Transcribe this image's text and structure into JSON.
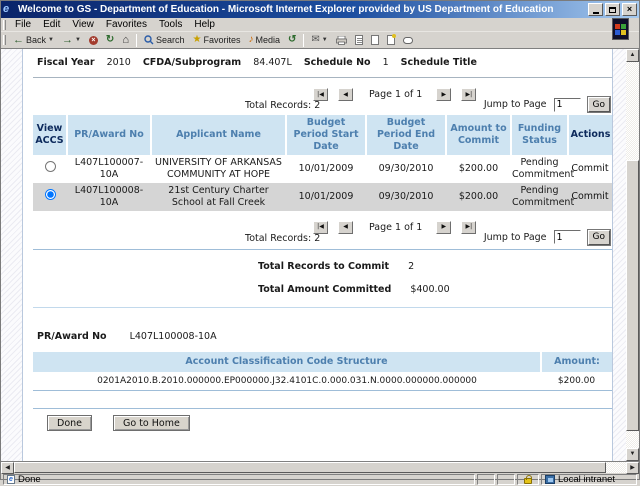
{
  "titlebar": {
    "title": "Welcome to GS - Department of Education - Microsoft Internet Explorer provided by US Department of Education"
  },
  "menubar": {
    "items": [
      "File",
      "Edit",
      "View",
      "Favorites",
      "Tools",
      "Help"
    ]
  },
  "toolbar": {
    "back_label": "Back",
    "search_label": "Search",
    "favorites_label": "Favorites",
    "media_label": "Media"
  },
  "icons": {
    "ie_e": "e",
    "back": "←",
    "forward": "→",
    "stop": "×",
    "refresh": "↻",
    "home": "⌂",
    "favorites": "★",
    "media": "♪",
    "history": "↺",
    "mail": "✉",
    "close": "×",
    "up": "▲",
    "down": "▼",
    "left": "◀",
    "right": "▶"
  },
  "page": {
    "header_fields": {
      "fy_label": "Fiscal Year",
      "fy": "2010",
      "cfda_label": "CFDA/Subprogram",
      "cfda": "84.407L",
      "sched_label": "Schedule No",
      "sched": "1",
      "title_label": "Schedule Title"
    },
    "pagination": {
      "total_label": "Total Records:",
      "total": "2",
      "first": "|◀",
      "prev": "◀",
      "next": "▶",
      "last": "▶|",
      "page": "Page 1 of 1",
      "jump_label": "Jump to Page",
      "jump_value": "1",
      "go": "Go"
    },
    "table": {
      "headers": [
        "View ACCS",
        "PR/Award No",
        "Applicant Name",
        "Budget Period Start Date",
        "Budget Period End Date",
        "Amount to Commit",
        "Funding Status",
        "Actions"
      ],
      "rows": [
        {
          "selected": false,
          "pr_award_no": "L407L100007-10A",
          "applicant": "UNIVERSITY OF ARKANSAS COMMUNITY AT HOPE",
          "start": "10/01/2009",
          "end": "09/30/2010",
          "amount": "$200.00",
          "status": "Pending Commitment",
          "action": "Commit"
        },
        {
          "selected": true,
          "pr_award_no": "L407L100008-10A",
          "applicant": "21st Century Charter School at Fall Creek",
          "start": "10/01/2009",
          "end": "09/30/2010",
          "amount": "$200.00",
          "status": "Pending Commitment",
          "action": "Commit"
        }
      ]
    },
    "totals": {
      "records_label": "Total Records to Commit",
      "records_value": "2",
      "amount_label": "Total Amount Committed",
      "amount_value": "$400.00"
    },
    "accs": {
      "pr_label": "PR/Award No",
      "pr_value": "L407L100008-10A",
      "code_header": "Account Classification Code Structure",
      "amount_header": "Amount:",
      "code": "0201A2010.B.2010.000000.EP000000.J32.4101C.0.000.031.N.0000.000000.000000",
      "amount": "$200.00"
    },
    "buttons": {
      "done": "Done",
      "home": "Go to Home"
    }
  },
  "statusbar": {
    "status": "Done",
    "zone": "Local intranet"
  }
}
